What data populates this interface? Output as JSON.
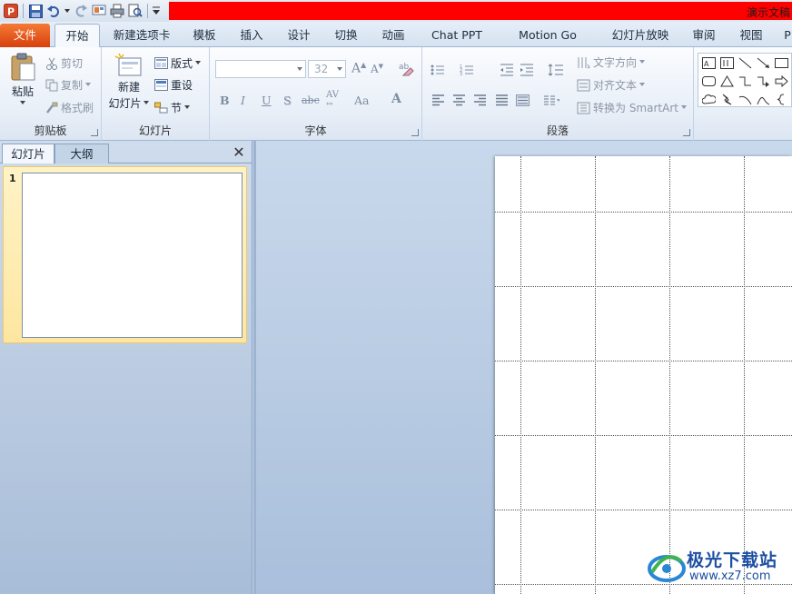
{
  "app": {
    "doc_title": "演示文稿"
  },
  "tabs": [
    {
      "label": "文件"
    },
    {
      "label": "开始"
    },
    {
      "label": "新建选项卡"
    },
    {
      "label": "模板"
    },
    {
      "label": "插入"
    },
    {
      "label": "设计"
    },
    {
      "label": "切换"
    },
    {
      "label": "动画"
    },
    {
      "label": "Chat PPT"
    },
    {
      "label": "Motion Go"
    },
    {
      "label": "幻灯片放映"
    },
    {
      "label": "审阅"
    },
    {
      "label": "视图"
    },
    {
      "label": "P"
    }
  ],
  "ribbon": {
    "clipboard": {
      "label": "剪贴板",
      "paste": "粘贴",
      "cut": "剪切",
      "copy": "复制",
      "format_painter": "格式刷"
    },
    "slides": {
      "label": "幻灯片",
      "new_slide_line1": "新建",
      "new_slide_line2": "幻灯片",
      "layout": "版式",
      "reset": "重设",
      "section": "节"
    },
    "font": {
      "label": "字体",
      "font_name": "",
      "font_size": "32",
      "bold": "B",
      "italic": "I",
      "underline": "U",
      "shadow": "S",
      "strike": "abc",
      "spacing": "AV",
      "case": "Aa",
      "color": "A"
    },
    "paragraph": {
      "label": "段落",
      "text_direction": "文字方向",
      "align_text": "对齐文本",
      "smartart": "转换为 SmartArt"
    }
  },
  "left_pane": {
    "tab_slides": "幻灯片",
    "tab_outline": "大纲",
    "close": "✕",
    "slide_number": "1"
  },
  "watermark": {
    "title": "极光下载站",
    "url": "www.xz7.com"
  },
  "colors": {
    "file_tab": "#e35a1e",
    "title_bar": "#ff0000",
    "selection": "#fde6a0"
  }
}
